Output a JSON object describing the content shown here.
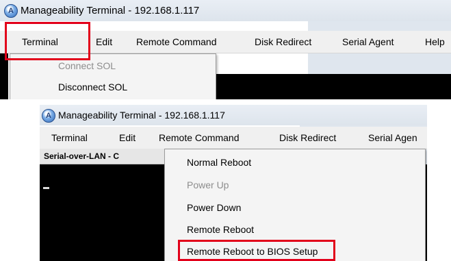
{
  "window": {
    "title": "Manageability Terminal - 192.168.1.117",
    "icon": "app-logo-icon",
    "icon_letter": "A"
  },
  "menu": {
    "terminal": "Terminal",
    "edit": "Edit",
    "remote_command": "Remote Command",
    "disk_redirect": "Disk Redirect",
    "serial_agent": "Serial Agent",
    "serial_agent_cut": "Serial Agen",
    "help": "Help"
  },
  "terminal_menu": {
    "items": [
      {
        "label": "Connect SOL",
        "enabled": false
      },
      {
        "label": "Disconnect SOL",
        "enabled": true
      }
    ]
  },
  "remote_command_menu": {
    "items": [
      {
        "label": "Normal Reboot",
        "enabled": true
      },
      {
        "label": "Power Up",
        "enabled": false
      },
      {
        "label": "Power Down",
        "enabled": true
      },
      {
        "label": "Remote Reboot",
        "enabled": true
      },
      {
        "label": "Remote Reboot to BIOS Setup",
        "enabled": true
      }
    ]
  },
  "panel": {
    "header": "Serial-over-LAN - C"
  },
  "colors": {
    "highlight": "#e2001a",
    "terminal_bg": "#000000",
    "menubar_bg": "#f0f0f0"
  }
}
